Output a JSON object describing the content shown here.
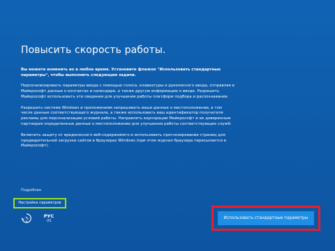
{
  "page": {
    "title": "Повысить скорость работы.",
    "paragraphs": [
      "Вы можете изменить их в любое время. Установите флажок \"Использовать стандартные параметры\", чтобы выполнить следующие задачи.",
      "Персонализировать параметры ввода с помощью голоса, клавиатуры и рукописного ввода, отправляя в Майкрософт данные о контактах и календаре, а также другую информацию о вводе. Разрешить Майкрософт использовать эти сведения для улучшения работы платформ подбора и распознавания.",
      "Разрешить системе Windows и приложениям запрашивать ваши данные о местоположении, в том числе данные соответствующего журнала, а также использовать ваш идентификатор получателя рекламы для персонализации условий работы. Направлять корпорации Майкрософт и ее доверенным партнерам определенные данные о местоположении для улучшения работы соответствующих служб.",
      "Включить защиту от вредоносного веб-содержимого и использовать прогнозирование страниц для предварительной загрузки сайтов в браузерах Windows (при этом журнал браузера пересылается в Майкрософт)."
    ]
  },
  "footer": {
    "more_link": "Подробнее",
    "customize_button": "Настройка параметров",
    "language_primary": "РУС",
    "language_secondary": "US",
    "express_button": "Использовать стандартные параметры",
    "accessibility_icon": "ease-of-access-icon"
  },
  "colors": {
    "background": "#0f5bab",
    "customize_highlight": "#9be31e",
    "express_highlight": "#e81f2b",
    "express_button": "#1f8fe5"
  }
}
